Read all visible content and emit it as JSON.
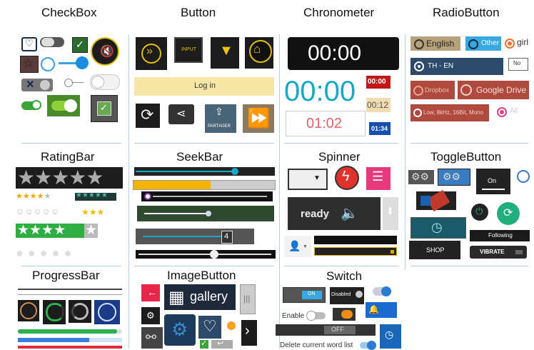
{
  "sections": {
    "checkbox": "CheckBox",
    "button": "Button",
    "chronometer": "Chronometer",
    "radiobutton": "RadioButton",
    "ratingbar": "RatingBar",
    "seekbar": "SeekBar",
    "spinner": "Spinner",
    "togglebutton": "ToggleButton",
    "progressbar": "ProgressBar",
    "imagebutton": "ImageButton",
    "switch": "Switch"
  },
  "button": {
    "input_label": "INPUT",
    "login_label": "Log in",
    "share_label": "PARTAGER"
  },
  "chronometer": {
    "big_dark": "00:00",
    "big_cyan": "00:00",
    "red_small": "00:00",
    "pink": "01:02",
    "beige": "00:12",
    "blue_small": "01:34"
  },
  "radio": {
    "english": "English",
    "other": "Other",
    "girl": "girl",
    "th_en": "TH - EN",
    "no": "No",
    "dropbox": "Dropbox",
    "google_drive": "Google Drive",
    "low": "Low, 8kHz, 16Bit, Mono",
    "all": "All"
  },
  "spinner": {
    "ready": "ready"
  },
  "toggle": {
    "on": "On",
    "following": "Following",
    "shop": "SHOP",
    "vibrate": "VIBRATE"
  },
  "imagebutton": {
    "gallery": "gallery"
  },
  "switch": {
    "on": "ON",
    "disabled": "Disabled",
    "enable": "Enable",
    "off": "OFF",
    "delete_words": "Delete current word list"
  },
  "progress": {
    "bar_value": 0.95
  },
  "colors": {
    "cyan": "#1ba8c6",
    "yellow": "#f2c200",
    "green": "#2bb24c",
    "red": "#e02b3c"
  }
}
